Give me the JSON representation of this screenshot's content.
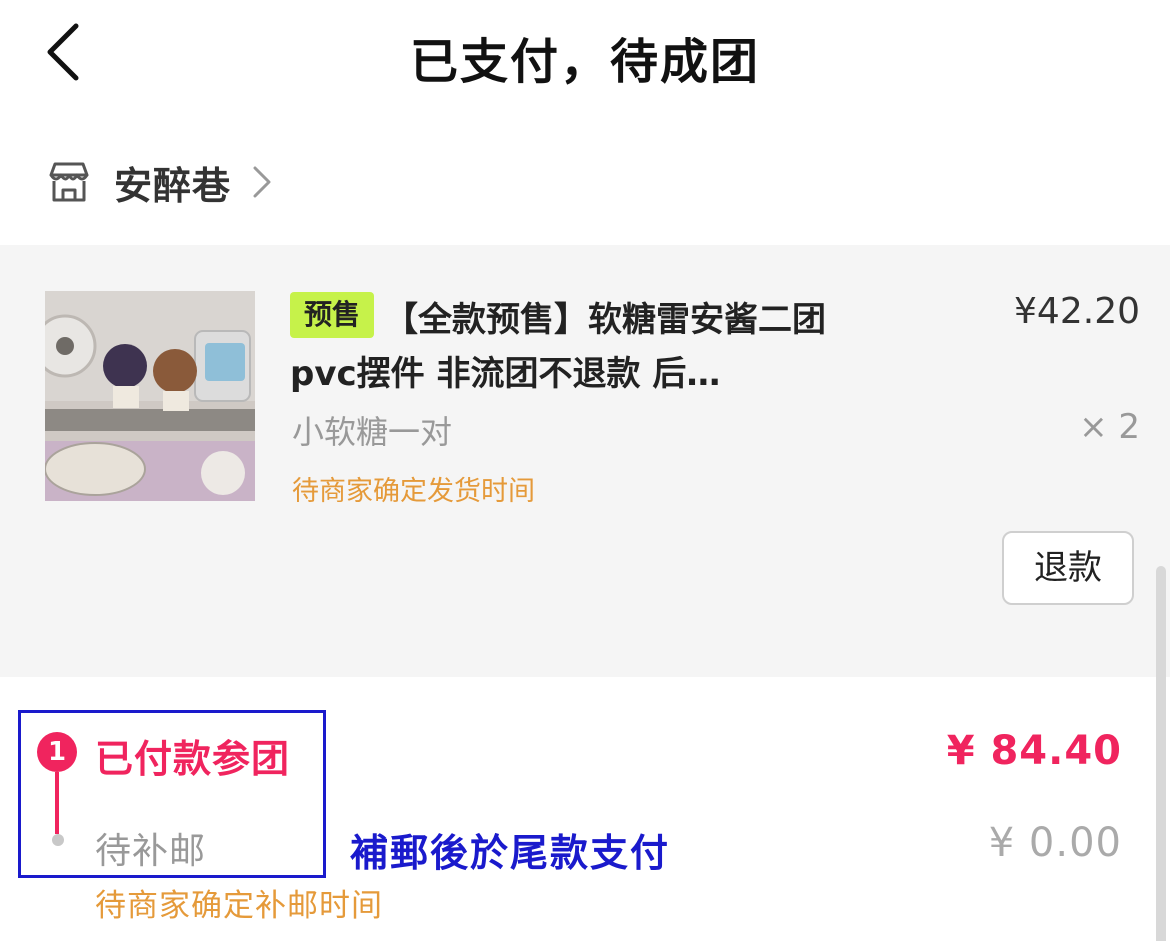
{
  "header": {
    "title": "已支付，待成团",
    "back_icon": "chevron-left-icon"
  },
  "store": {
    "icon": "storefront-icon",
    "name": "安醉巷",
    "chevron_icon": "chevron-right-icon"
  },
  "product": {
    "badge": "预售",
    "title": "【全款预售】软糖雷安酱二团 pvc摆件 非流团不退款 后…",
    "price": "¥42.20",
    "variant": "小软糖一对",
    "quantity": "× 2",
    "shipping_note": "待商家确定发货时间",
    "refund_label": "退款"
  },
  "payment_steps": [
    {
      "index": "1",
      "label": "已付款参团",
      "amount": "¥ 84.40",
      "status": "done",
      "color": "#f0245e"
    },
    {
      "label": "待补邮",
      "amount": "¥ 0.00",
      "note": "待商家确定补邮时间",
      "status": "pending"
    }
  ],
  "annotation": {
    "text": "補郵後於尾款支付",
    "color": "#1a1acc"
  },
  "colors": {
    "accent": "#f0245e",
    "warning": "#e59a3a",
    "badge": "#c6f24a"
  }
}
